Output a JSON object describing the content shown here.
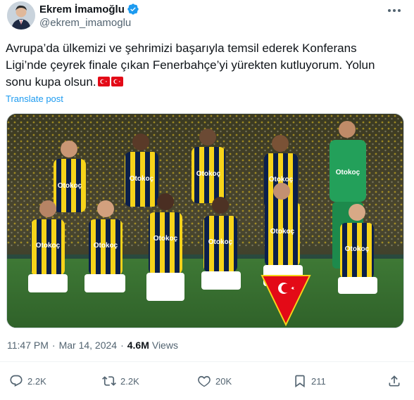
{
  "author": {
    "display_name": "Ekrem İmamoğlu",
    "handle": "@ekrem_imamoglu",
    "verified_icon": "verified-badge-icon",
    "verified_color": "#1d9bf0"
  },
  "tweet": {
    "text_lines": [
      "Avrupa’da ülkemizi ve şehrimizi başarıyla temsil ederek Konferans",
      "Ligi’nde çeyrek finale çıkan Fenerbahçe’yi yürekten kutluyorum. Yolun",
      "sonu kupa olsun."
    ],
    "emojis": [
      "turkey-flag-icon",
      "turkey-flag-icon"
    ],
    "translate_label": "Translate post",
    "link_color": "#1d9bf0"
  },
  "media": {
    "description_icon": "team-photo-image",
    "sponsor_text": "Otokoç",
    "team_colors": [
      "#0b1f4b",
      "#f6d31a",
      "#ffffff"
    ],
    "keeper_color": "#23a05a"
  },
  "meta": {
    "time": "11:47 PM",
    "date": "Mar 14, 2024",
    "views_count": "4.6M",
    "views_label": "Views"
  },
  "actions": {
    "reply_count": "2.2K",
    "retweet_count": "2.2K",
    "like_count": "20K",
    "bookmark_count": "211"
  }
}
